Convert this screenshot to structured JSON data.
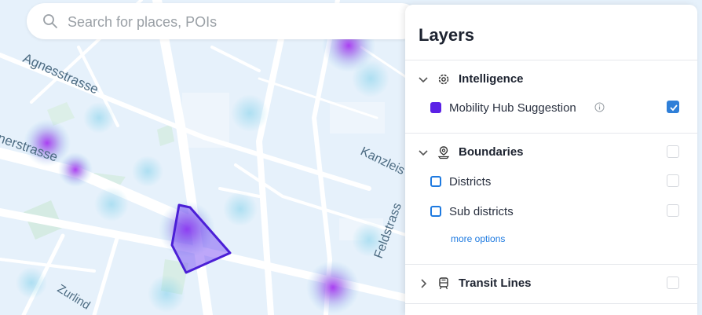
{
  "search": {
    "placeholder": "Search for places, POIs"
  },
  "map": {
    "street_labels": [
      "Agnesstrasse",
      "nerstrasse",
      "Kanzleis",
      "Feldstrass",
      "Zurlind"
    ]
  },
  "layers_panel": {
    "title": "Layers",
    "groups": [
      {
        "label": "Intelligence",
        "icon": "gear-icon",
        "expanded": true,
        "items": [
          {
            "label": "Mobility Hub Suggestion",
            "checked": true,
            "swatch_color": "#5b21e6",
            "has_info": true
          }
        ]
      },
      {
        "label": "Boundaries",
        "icon": "boundary-pin-icon",
        "expanded": true,
        "checked": false,
        "items": [
          {
            "label": "Districts",
            "checked": false,
            "swatch_color": "#1e7ae0"
          },
          {
            "label": "Sub districts",
            "checked": false,
            "swatch_color": "#1e7ae0"
          }
        ],
        "more_options": "more options"
      },
      {
        "label": "Transit Lines",
        "icon": "transit-icon",
        "expanded": false,
        "checked": false
      }
    ]
  },
  "colors": {
    "accent": "#2f7fd8",
    "polygon": "#4b1fd6",
    "heat": "#a14be6"
  }
}
